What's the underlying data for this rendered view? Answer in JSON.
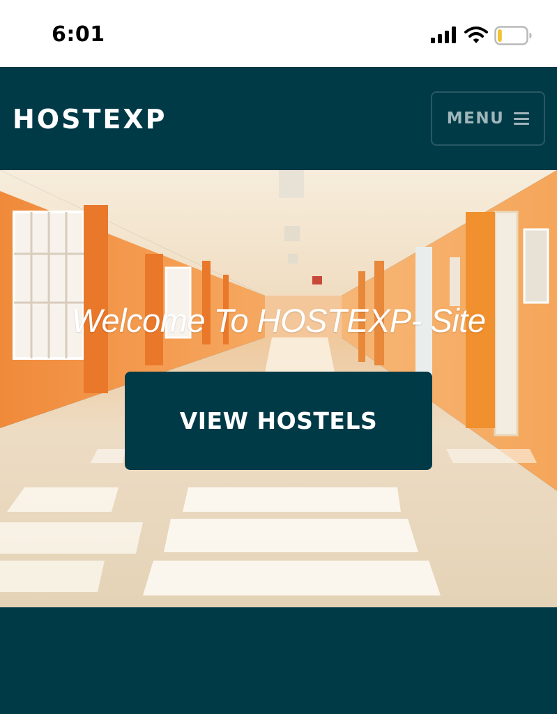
{
  "status_bar": {
    "time": "6:01",
    "icons": [
      "cellular-signal-icon",
      "wifi-icon",
      "battery-icon"
    ],
    "battery_level": 0.15,
    "battery_color": "#f2c230"
  },
  "header": {
    "brand": "HOSTEXP",
    "menu_label": "MENU",
    "menu_icon": "hamburger-icon"
  },
  "hero": {
    "title": "Welcome To HOSTEXP- Site",
    "cta_label": "VIEW HOSTELS"
  },
  "colors": {
    "brand_dark": "#013a47",
    "menu_text": "#9fb6bb",
    "hero_wall": "#f5a150",
    "hero_floor": "#eadcc4"
  }
}
